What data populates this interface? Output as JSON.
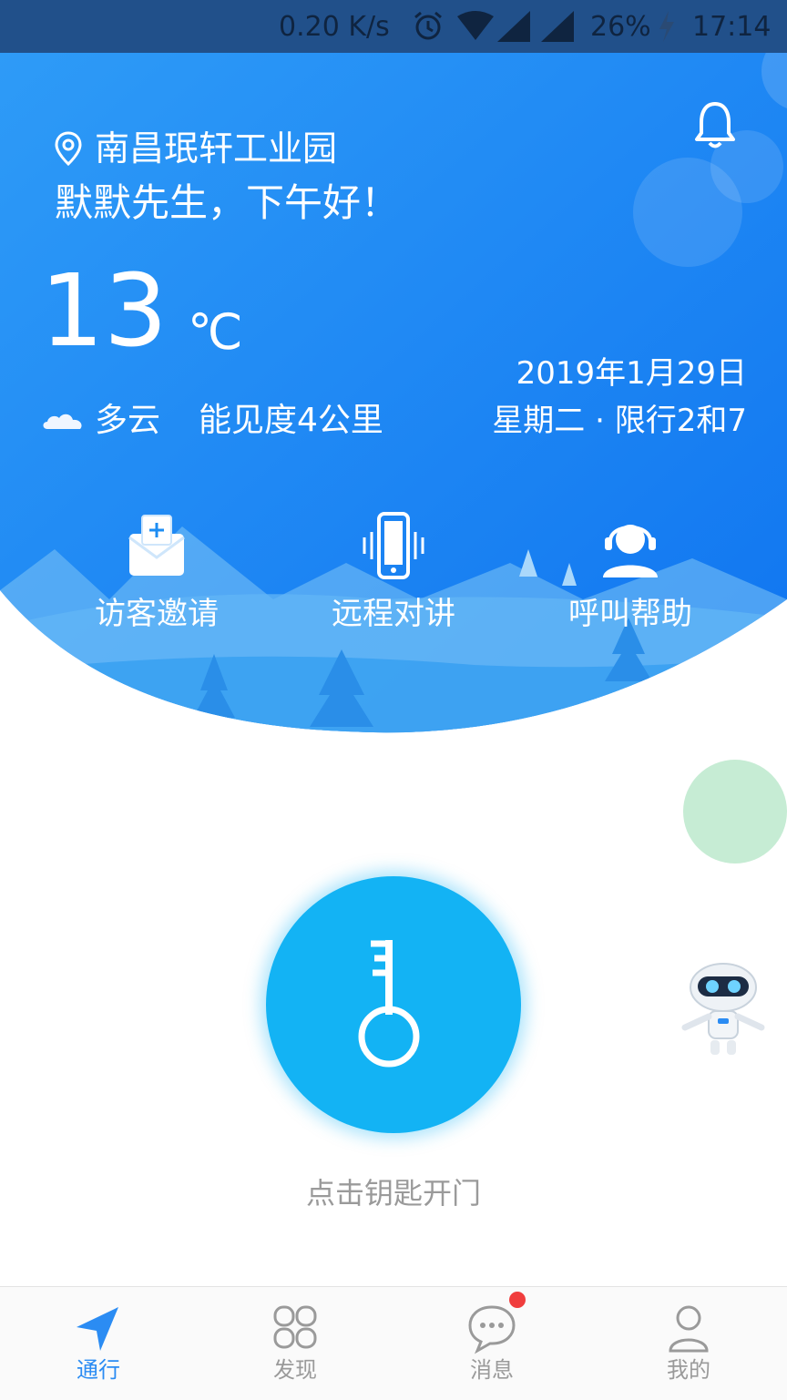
{
  "status_bar": {
    "speed": "0.20 K/s",
    "battery": "26%",
    "time": "17:14"
  },
  "header": {
    "location": "南昌珉轩工业园",
    "greeting": "默默先生，下午好！",
    "temperature": "13",
    "temp_unit": "℃",
    "weather": "多云",
    "visibility": "能见度4公里",
    "date": "2019年1月29日",
    "weekday_restriction": "星期二 · 限行2和7"
  },
  "actions": [
    {
      "label": "访客邀请",
      "icon": "visitor-invite-icon"
    },
    {
      "label": "远程对讲",
      "icon": "phone-intercom-icon"
    },
    {
      "label": "呼叫帮助",
      "icon": "headset-help-icon"
    }
  ],
  "main": {
    "key_hint": "点击钥匙开门",
    "key_icon": "key-icon"
  },
  "tabs": [
    {
      "label": "通行",
      "icon": "navigation-arrow-icon",
      "active": true
    },
    {
      "label": "发现",
      "icon": "grid-icon",
      "active": false
    },
    {
      "label": "消息",
      "icon": "chat-bubble-icon",
      "active": false,
      "badge": true
    },
    {
      "label": "我的",
      "icon": "user-icon",
      "active": false
    }
  ],
  "colors": {
    "primary": "#1a8cf4",
    "active_tab": "#2b8cf3",
    "inactive_tab": "#9a9a9a",
    "key_button": "#13b3f4",
    "badge": "#f03d3d"
  }
}
